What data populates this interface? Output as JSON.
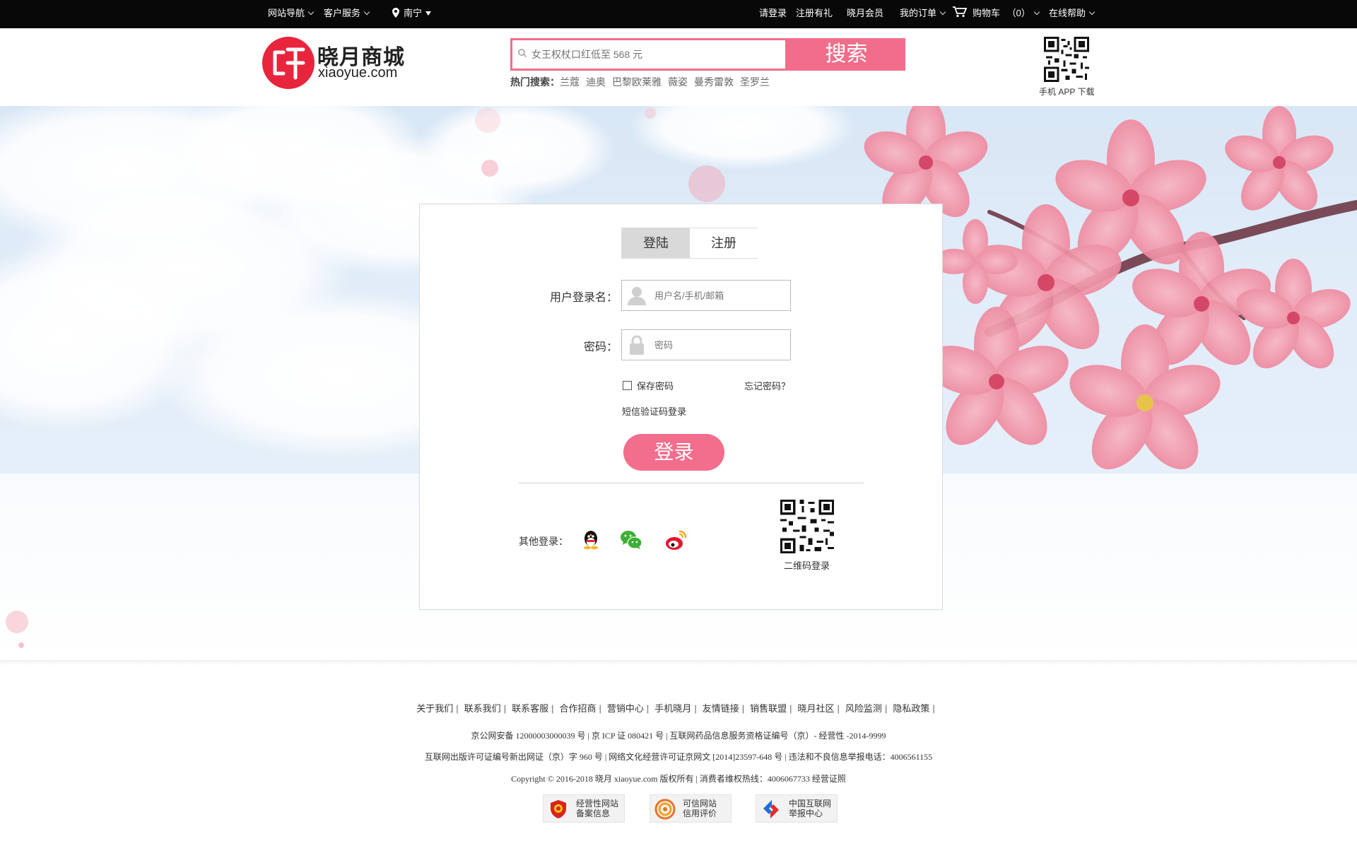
{
  "topbar": {
    "site_nav": "网站导航",
    "customer_service": "客户服务",
    "city": "南宁",
    "login": "请登录",
    "register": "注册有礼",
    "member": "晓月会员",
    "orders": "我的订单",
    "cart": "购物车",
    "cart_count": "（0）",
    "help": "在线帮助"
  },
  "header": {
    "logo_name": "晓月商城",
    "logo_domain": "xiaoyue.com",
    "search_placeholder": "女王权杖口红低至 568 元",
    "search_button": "搜索",
    "hot_label": "热门搜索：",
    "hot_keywords": [
      "兰蔻",
      "迪奥",
      "巴黎欧莱雅",
      "薇姿",
      "曼秀雷敦",
      "圣罗兰"
    ],
    "app_download": "手机 APP 下载"
  },
  "login_panel": {
    "tab_login": "登陆",
    "tab_register": "注册",
    "username_label": "用户登录名：",
    "username_placeholder": "用户名/手机/邮箱",
    "password_label": "密码：",
    "password_placeholder": "密码",
    "remember": "保存密码",
    "forgot": "忘记密码？",
    "sms_login": "短信验证码登录",
    "submit": "登录",
    "other_login": "其他登录：",
    "social_icons": [
      "qq-icon",
      "wechat-icon",
      "weibo-icon"
    ],
    "qr_login": "二维码登录"
  },
  "footer": {
    "links": [
      "关于我们",
      "联系我们",
      "联系客服",
      "合作招商",
      "营销中心",
      "手机晓月",
      "友情链接",
      "销售联盟",
      "晓月社区",
      "风险监测",
      "隐私政策"
    ],
    "line1": "京公网安备 12000003000039 号   |   京 ICP 证 080421 号   |   互联网药品信息服务资格证编号（京）- 经营性 -2014-9999",
    "line2": "互联网出版许可证编号新出网证（京）字 960 号 |  网络文化经营许可证京网文 [2014]23597-648 号   |   违法和不良信息举报电话：4006561155",
    "line3": "Copyright © 2016-2018  晓月 xiaoyue.com 版权所有   |   消费者维权热线：4006067733      经营证照",
    "badges": [
      {
        "line1": "经营性网站",
        "line2": "备案信息"
      },
      {
        "line1": "可信网站",
        "line2": "信用评价"
      },
      {
        "line1": "中国互联网",
        "line2": "举报中心"
      }
    ]
  },
  "colors": {
    "accent_pink": "#f26d8a",
    "logo_red": "#e8253d",
    "topbar_bg": "#080808"
  }
}
